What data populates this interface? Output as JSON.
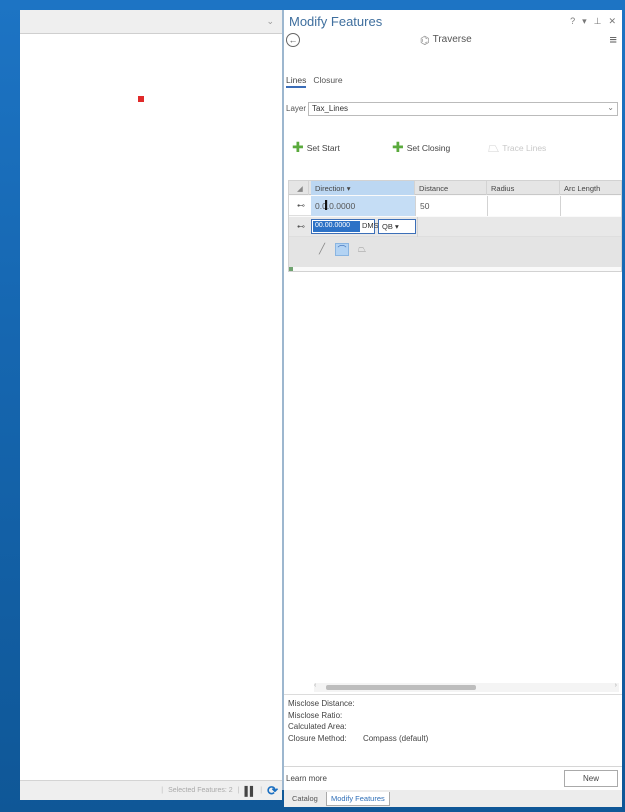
{
  "map": {
    "statusbar": {
      "selected_features": "Selected Features: 2",
      "separator": "|",
      "pause_glyph": "▌▌",
      "refresh_glyph": "⟳"
    }
  },
  "pane": {
    "title": "Modify Features",
    "controls": {
      "help": "?",
      "menu": "▾",
      "pin": "⊥",
      "close": "✕"
    },
    "back_glyph": "←",
    "tool_icon": "⌬",
    "tool_name": "Traverse",
    "menu_glyph": "≡",
    "tabs": {
      "lines": "Lines",
      "closure": "Closure"
    },
    "layer": {
      "label": "Layer",
      "value": "Tax_Lines",
      "dropdown_glyph": "⌄"
    },
    "toolbar": {
      "set_start": "Set Start",
      "set_closing": "Set Closing",
      "trace_lines": "Trace Lines"
    },
    "grid": {
      "corner_glyph": "◢",
      "columns": [
        "Direction",
        "Distance",
        "Radius",
        "Arc Length"
      ],
      "direction_sort_glyph": "▾",
      "rows": [
        {
          "icon": "⊷",
          "direction": "0.0.0.0000",
          "distance": "50"
        }
      ],
      "edit_row": {
        "icon": "⊷",
        "direction_value": "00.00.0000",
        "unit": "DMS",
        "unit_dropdown": "QB",
        "dropdown_glyph": "▾"
      },
      "segment_tools": {
        "line": "╱",
        "arc": "⌒",
        "freeform": "⏢"
      }
    },
    "scrollbar": {
      "left": "‹",
      "right": "›"
    },
    "closure": {
      "misclose_distance": "Misclose Distance:",
      "misclose_ratio": "Misclose Ratio:",
      "calculated_area": "Calculated Area:",
      "closure_method_label": "Closure Method:",
      "closure_method_value": "Compass (default)"
    },
    "footer": {
      "learn_more": "Learn more",
      "new_button": "New"
    }
  },
  "dock_tabs": {
    "catalog": "Catalog",
    "modify_features": "Modify Features"
  },
  "colors": {
    "desktop_bg": "#1667b1",
    "pane_title": "#3f6f9e",
    "selection_blue": "#2d72c6",
    "header_highlight": "#bcd7f2",
    "row_accent_green": "#6fa370",
    "map_point_red": "#e02a2a"
  }
}
